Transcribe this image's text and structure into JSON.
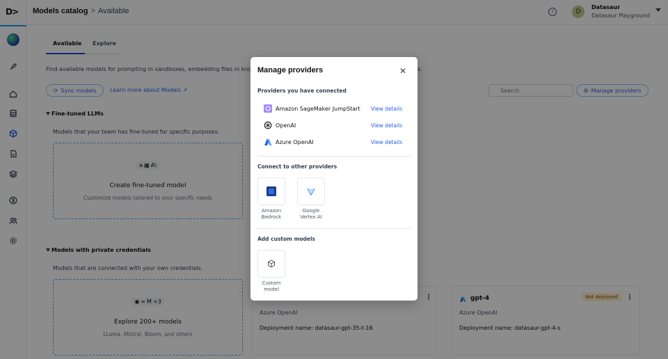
{
  "app": {
    "logo": "D>"
  },
  "header": {
    "breadcrumb_root": "Models catalog",
    "breadcrumb_sep": ">",
    "breadcrumb_current": "Available",
    "help_icon": "?",
    "user_initial": "D",
    "user_name": "Datasaur",
    "workspace": "Datasaur Playground"
  },
  "tabs": [
    {
      "label": "Available"
    },
    {
      "label": "Explore"
    }
  ],
  "page": {
    "description": "Find available models for prompting in sandboxes, embedding files in know",
    "description_tail": "s.",
    "sync_label": "Sync models",
    "learn_label": "Learn more about Models",
    "search_placeholder": "Search",
    "manage_label": "Manage providers"
  },
  "sections": {
    "fine_tuned": {
      "title": "Fine-tuned LLMs",
      "description": "Models that your team has fine-tuned for specific purposes.",
      "card_title": "Create fine-tuned model",
      "card_sub": "Customize models tailored to your specific needs",
      "logos": [
        "a",
        "▦",
        "A\\"
      ]
    },
    "private": {
      "title": "Models with private credentials",
      "description": "Models that are connected with your own credentials.",
      "card_title": "Explore 200+ models",
      "card_sub": "LLama, Mistral, Bloom, and others",
      "logos": [
        "◉",
        "∞",
        "M",
        "+3"
      ]
    }
  },
  "model_cards": [
    {
      "provider": "Azure OpenAI",
      "deployment": "Deployment name: datasaur-gpt-35-t-16"
    },
    {
      "name": "gpt-4",
      "badge": "Not deployed",
      "provider": "Azure OpenAI",
      "deployment": "Deployment name: datasaur-gpt-4-s"
    }
  ],
  "modal": {
    "title": "Manage providers",
    "connected_heading": "Providers you have connected",
    "connected": [
      {
        "name": "Amazon SageMaker JumpStart",
        "link": "View details",
        "icon": "sagemaker-icon",
        "color": "#a78bfa"
      },
      {
        "name": "OpenAI",
        "link": "View details",
        "icon": "openai-icon",
        "color": "#111111"
      },
      {
        "name": "Azure OpenAI",
        "link": "View details",
        "icon": "azure-icon",
        "color": "#2563eb"
      }
    ],
    "other_heading": "Connect to other providers",
    "other": [
      {
        "line1": "Amazon",
        "line2": "Bedrock",
        "icon": "bedrock-icon"
      },
      {
        "line1": "Google",
        "line2": "Vertex AI",
        "icon": "vertex-icon"
      }
    ],
    "custom_heading": "Add custom models",
    "custom": {
      "line1": "Custom",
      "line2": "model",
      "icon": "cube-icon"
    }
  },
  "colors": {
    "accent": "#2563eb",
    "badge_bg": "#fef3c7",
    "overlay": "rgba(0,0,0,0.45)"
  }
}
